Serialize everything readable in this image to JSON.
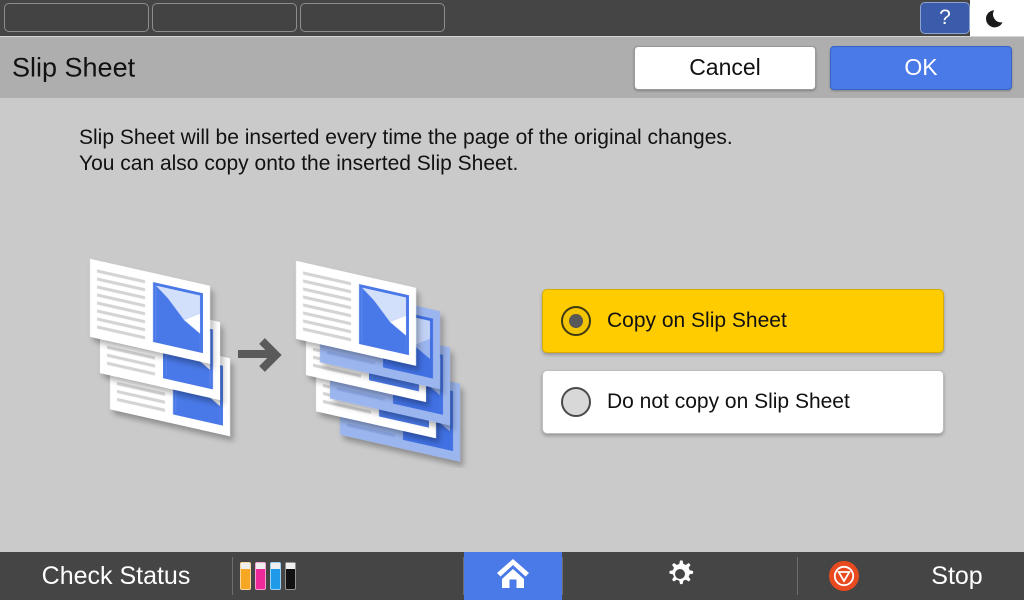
{
  "topbar": {
    "tabs": [
      {
        "label": "",
        "name": "top-tab-1"
      },
      {
        "label": "",
        "name": "top-tab-2"
      },
      {
        "label": "",
        "name": "top-tab-3"
      }
    ],
    "help_label": "?",
    "sleep_icon": "moon-icon"
  },
  "header": {
    "title": "Slip Sheet",
    "cancel_label": "Cancel",
    "ok_label": "OK"
  },
  "content": {
    "description": "Slip Sheet will be inserted every time the page of the original changes.\nYou can also copy onto the inserted Slip Sheet.",
    "illustration": {
      "name": "slip-sheet-illustration",
      "left_stack_sheets": 3,
      "right_stack_sheets": 3,
      "right_stack_slip_sheets": 3,
      "arrow": "arrow-right-icon"
    }
  },
  "options": [
    {
      "label": "Copy on Slip Sheet",
      "selected": true,
      "name": "option-copy-on-slip-sheet"
    },
    {
      "label": "Do not copy on Slip Sheet",
      "selected": false,
      "name": "option-do-not-copy-on-slip-sheet"
    }
  ],
  "bottombar": {
    "check_status_label": "Check Status",
    "toners": [
      {
        "name": "toner-yellow",
        "color": "#f5a623"
      },
      {
        "name": "toner-magenta",
        "color": "#ee2a9b"
      },
      {
        "name": "toner-cyan",
        "color": "#1e9ae8"
      },
      {
        "name": "toner-black",
        "color": "#111111"
      }
    ],
    "home_icon": "home-icon",
    "settings_icon": "gear-icon",
    "stop_icon": "stop-icon",
    "stop_label": "Stop"
  },
  "colors": {
    "accent_blue": "#4a79e8",
    "selected_yellow": "#ffcc00",
    "bar_dark": "#454545",
    "header_gray": "#aeaeae",
    "body_gray": "#cacaca",
    "stop_orange": "#e8491f"
  }
}
